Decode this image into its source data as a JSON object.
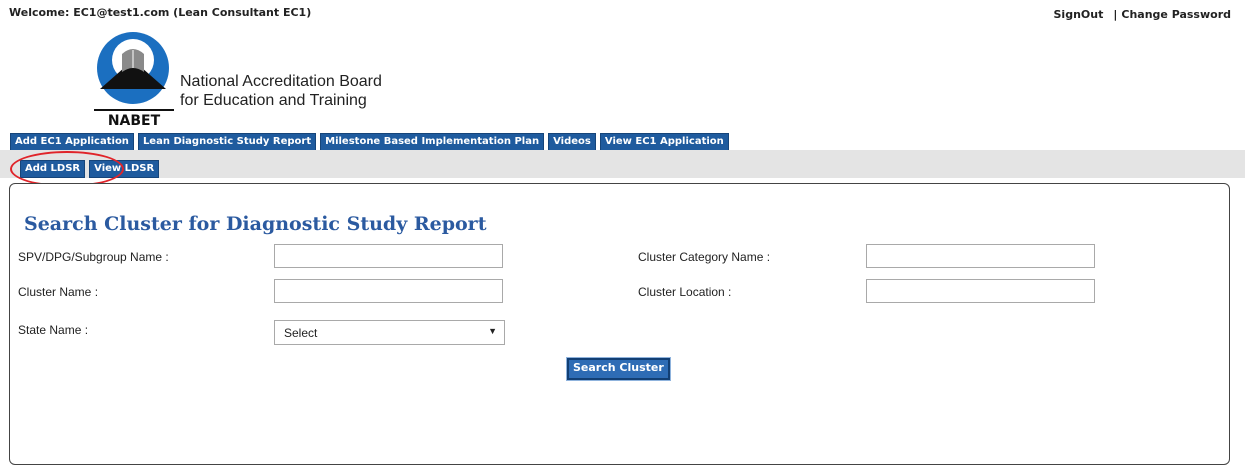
{
  "header": {
    "welcome_text": "Welcome: EC1@test1.com (Lean Consultant EC1)",
    "signout_label": "SignOut",
    "separator": "|",
    "change_password_label": "Change Password"
  },
  "brand": {
    "logo_text": "NABET",
    "org_line1": "National Accreditation Board",
    "org_line2": "for Education and Training"
  },
  "nav": {
    "tabs": [
      {
        "label": "Add EC1 Application"
      },
      {
        "label": "Lean Diagnostic Study Report"
      },
      {
        "label": "Milestone Based Implementation Plan"
      },
      {
        "label": "Videos"
      },
      {
        "label": "View EC1 Application"
      }
    ],
    "subtabs": [
      {
        "label": "Add LDSR"
      },
      {
        "label": "View LDSR"
      }
    ]
  },
  "search_form": {
    "title": "Search Cluster for Diagnostic Study Report",
    "spv_label": "SPV/DPG/Subgroup Name :",
    "spv_value": "",
    "category_label": "Cluster Category Name :",
    "category_value": "",
    "cluster_name_label": "Cluster Name :",
    "cluster_name_value": "",
    "location_label": "Cluster Location :",
    "location_value": "",
    "state_label": "State Name :",
    "state_selected": "Select",
    "search_button": "Search Cluster"
  },
  "colors": {
    "tab_bg": "#1f5b9e",
    "title_color": "#2b5aa0",
    "highlight": "#e0242a",
    "subnav_bg": "#e4e4e4"
  }
}
